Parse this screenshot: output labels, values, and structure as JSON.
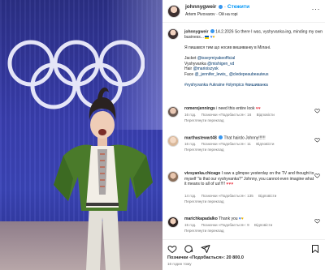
{
  "photo": {},
  "post": {
    "username": "johnnygweir",
    "follow_label": "Стежити",
    "audio_label": "Artem Pivovarov · Ой на горі",
    "caption": {
      "username": "johnnygweir",
      "date": "14.2.2026",
      "line1": "So there I was, vyshyvanka-ing, minding my own business...",
      "line2": "Я пишався тим що носив вишиванку в Мілані.",
      "credits": [
        {
          "label": "Jacket",
          "handle": "@isseymiyakeofficial"
        },
        {
          "label": "Vyshyvanka",
          "handle": "@mishigen_vd"
        },
        {
          "label": "Hair",
          "handle": "@marioiszysk"
        },
        {
          "label": "Face",
          "handle": "@_jennifer_lewis_ @cledepeaubeauteus"
        }
      ],
      "hashtags": "#vyshyvanka #ukraine #olympics #вишиванка"
    },
    "comments": [
      {
        "username": "romerojennings",
        "text": "i need this entire look",
        "meta": [
          "16 год.",
          "Позначки «Подобається»: 16",
          "Відповісти"
        ],
        "translate": "Переглянути переклад"
      },
      {
        "username": "marthastewart48",
        "text": "That hairdo Johnny!!!!!!",
        "meta": [
          "16 год.",
          "Позначки «Подобається»: 11",
          "Відповісти"
        ],
        "translate": "Переглянути переклад"
      },
      {
        "username": "vivsyanka.chicago",
        "text": "I saw a glimpse yesterday on the TV and thought to myself \"is that our vyshyvanka?\" Johnny, you cannot even imagine what it means to all of us!!!!!",
        "meta": [
          "14 год.",
          "Позначки «Подобається»: 135",
          "Відповісти"
        ],
        "translate": "Переглянути переклад"
      },
      {
        "username": "marichkapadalko",
        "text": "Thank you",
        "meta": [
          "15 год.",
          "Позначки «Подобається»: 9",
          "Відповісти"
        ],
        "translate": "Переглянути переклад"
      }
    ],
    "likes": "Позначки «Подобається»: 20 800.0",
    "time": "16 годин тому"
  },
  "colors": {
    "accent": "#0095f6",
    "like_red": "#ed4956",
    "text": "#262626",
    "muted": "#737373"
  }
}
